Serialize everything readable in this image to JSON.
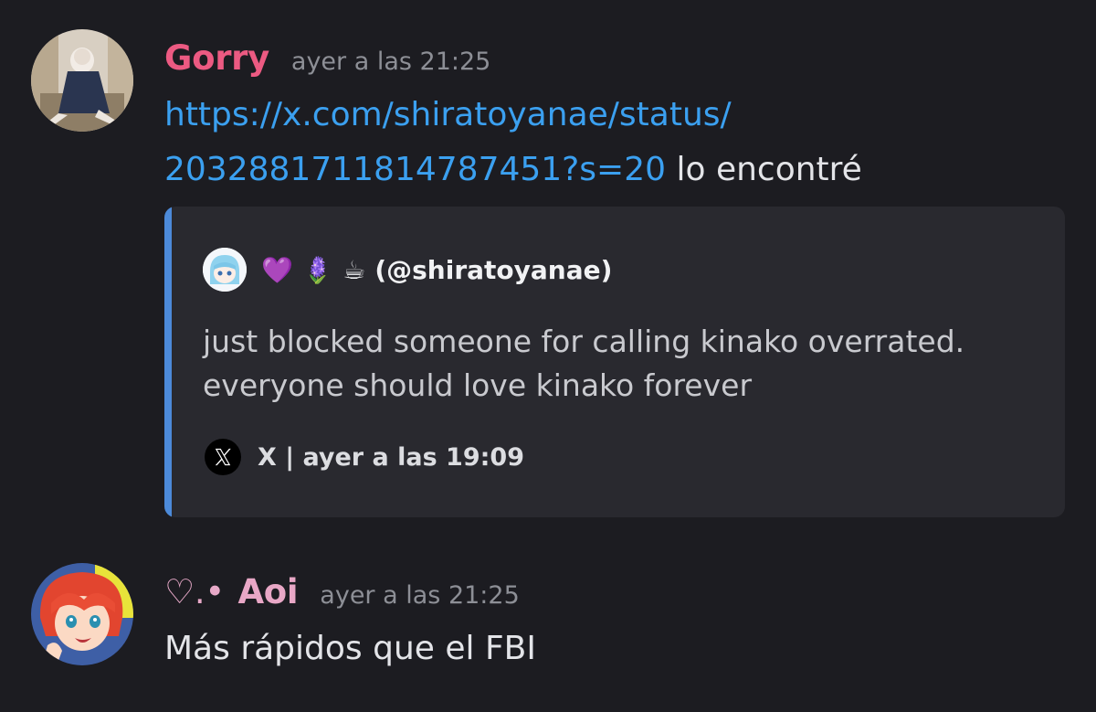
{
  "messages": [
    {
      "username": "Gorry",
      "username_color": "#ec5a82",
      "timestamp": "ayer a las 21:25",
      "link_line1": "https://x.com/shiratoyanae/status/",
      "link_line2": "2032881711814787451?s=20",
      "text_after_link": " lo encontré",
      "avatar_icon": "anime-character-avatar"
    },
    {
      "username_prefix": "♡.•",
      "username": "Aoi",
      "username_color": "#e8a7c6",
      "timestamp": "ayer a las 21:25",
      "text": "Más rápidos que el FBI",
      "avatar_icon": "red-haired-anime-avatar"
    }
  ],
  "embed": {
    "author_emojis": "💜 🪻 ☕",
    "author_handle": "(@shiratoyanae)",
    "text_line1": "just blocked someone for calling kinako overrated.",
    "text_line2": "everyone should love kinako forever",
    "footer": "X | ayer a las 19:09",
    "accent_color": "#4c8ad9",
    "provider_icon": "x-logo-icon"
  }
}
